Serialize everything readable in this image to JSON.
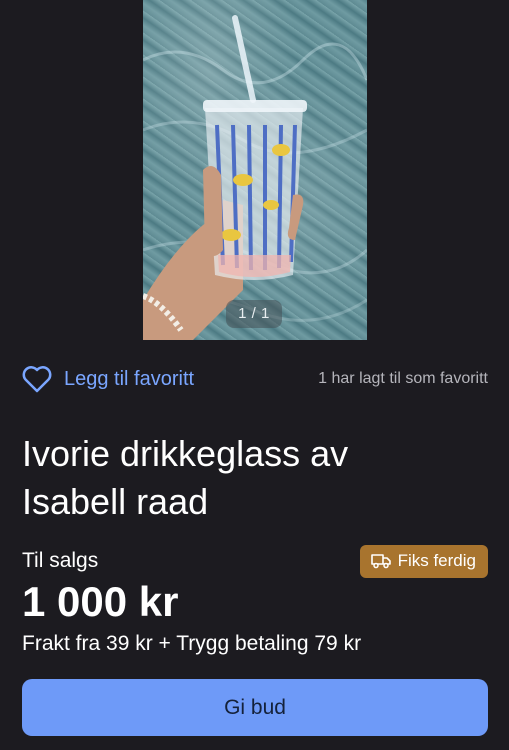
{
  "gallery": {
    "counter": "1 / 1",
    "image_alt": "Glass with straw held over pool"
  },
  "favorite": {
    "label": "Legg til favoritt",
    "count_text": "1 har lagt til som favoritt",
    "icon": "heart-outline-icon",
    "accent_color": "#7aa6ff"
  },
  "listing": {
    "title": "Ivorie drikkeglass av Isabell raad",
    "status": "Til salgs",
    "badge": {
      "label": "Fiks ferdig",
      "icon": "truck-icon",
      "color": "#a8742e"
    },
    "price": "1 000 kr",
    "shipping": "Frakt fra 39 kr + Trygg betaling 79 kr"
  },
  "actions": {
    "bid_label": "Gi bud",
    "bid_color": "#6e9af8"
  }
}
